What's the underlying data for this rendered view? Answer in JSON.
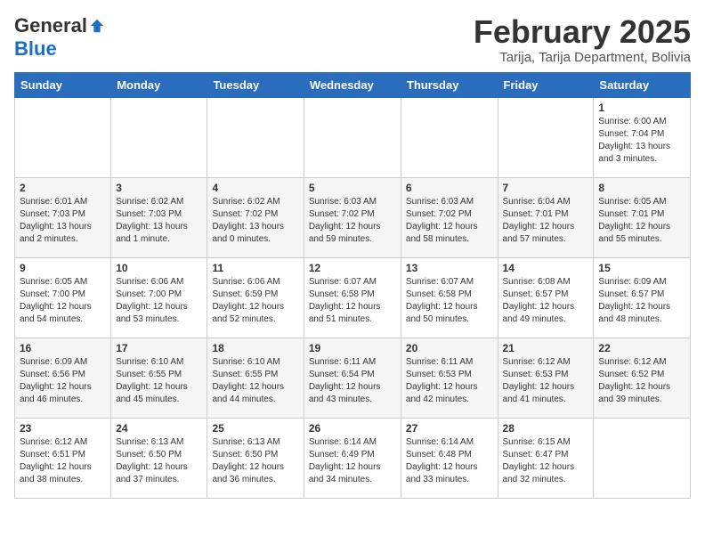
{
  "header": {
    "logo_general": "General",
    "logo_blue": "Blue",
    "month_title": "February 2025",
    "location": "Tarija, Tarija Department, Bolivia"
  },
  "weekdays": [
    "Sunday",
    "Monday",
    "Tuesday",
    "Wednesday",
    "Thursday",
    "Friday",
    "Saturday"
  ],
  "weeks": [
    [
      null,
      null,
      null,
      null,
      null,
      null,
      {
        "day": "1",
        "sunrise": "6:00 AM",
        "sunset": "7:04 PM",
        "daylight": "13 hours and 3 minutes."
      }
    ],
    [
      {
        "day": "2",
        "sunrise": "6:01 AM",
        "sunset": "7:03 PM",
        "daylight": "13 hours and 2 minutes."
      },
      {
        "day": "3",
        "sunrise": "6:02 AM",
        "sunset": "7:03 PM",
        "daylight": "13 hours and 1 minute."
      },
      {
        "day": "4",
        "sunrise": "6:02 AM",
        "sunset": "7:02 PM",
        "daylight": "13 hours and 0 minutes."
      },
      {
        "day": "5",
        "sunrise": "6:03 AM",
        "sunset": "7:02 PM",
        "daylight": "12 hours and 59 minutes."
      },
      {
        "day": "6",
        "sunrise": "6:03 AM",
        "sunset": "7:02 PM",
        "daylight": "12 hours and 58 minutes."
      },
      {
        "day": "7",
        "sunrise": "6:04 AM",
        "sunset": "7:01 PM",
        "daylight": "12 hours and 57 minutes."
      },
      {
        "day": "8",
        "sunrise": "6:05 AM",
        "sunset": "7:01 PM",
        "daylight": "12 hours and 55 minutes."
      }
    ],
    [
      {
        "day": "9",
        "sunrise": "6:05 AM",
        "sunset": "7:00 PM",
        "daylight": "12 hours and 54 minutes."
      },
      {
        "day": "10",
        "sunrise": "6:06 AM",
        "sunset": "7:00 PM",
        "daylight": "12 hours and 53 minutes."
      },
      {
        "day": "11",
        "sunrise": "6:06 AM",
        "sunset": "6:59 PM",
        "daylight": "12 hours and 52 minutes."
      },
      {
        "day": "12",
        "sunrise": "6:07 AM",
        "sunset": "6:58 PM",
        "daylight": "12 hours and 51 minutes."
      },
      {
        "day": "13",
        "sunrise": "6:07 AM",
        "sunset": "6:58 PM",
        "daylight": "12 hours and 50 minutes."
      },
      {
        "day": "14",
        "sunrise": "6:08 AM",
        "sunset": "6:57 PM",
        "daylight": "12 hours and 49 minutes."
      },
      {
        "day": "15",
        "sunrise": "6:09 AM",
        "sunset": "6:57 PM",
        "daylight": "12 hours and 48 minutes."
      }
    ],
    [
      {
        "day": "16",
        "sunrise": "6:09 AM",
        "sunset": "6:56 PM",
        "daylight": "12 hours and 46 minutes."
      },
      {
        "day": "17",
        "sunrise": "6:10 AM",
        "sunset": "6:55 PM",
        "daylight": "12 hours and 45 minutes."
      },
      {
        "day": "18",
        "sunrise": "6:10 AM",
        "sunset": "6:55 PM",
        "daylight": "12 hours and 44 minutes."
      },
      {
        "day": "19",
        "sunrise": "6:11 AM",
        "sunset": "6:54 PM",
        "daylight": "12 hours and 43 minutes."
      },
      {
        "day": "20",
        "sunrise": "6:11 AM",
        "sunset": "6:53 PM",
        "daylight": "12 hours and 42 minutes."
      },
      {
        "day": "21",
        "sunrise": "6:12 AM",
        "sunset": "6:53 PM",
        "daylight": "12 hours and 41 minutes."
      },
      {
        "day": "22",
        "sunrise": "6:12 AM",
        "sunset": "6:52 PM",
        "daylight": "12 hours and 39 minutes."
      }
    ],
    [
      {
        "day": "23",
        "sunrise": "6:12 AM",
        "sunset": "6:51 PM",
        "daylight": "12 hours and 38 minutes."
      },
      {
        "day": "24",
        "sunrise": "6:13 AM",
        "sunset": "6:50 PM",
        "daylight": "12 hours and 37 minutes."
      },
      {
        "day": "25",
        "sunrise": "6:13 AM",
        "sunset": "6:50 PM",
        "daylight": "12 hours and 36 minutes."
      },
      {
        "day": "26",
        "sunrise": "6:14 AM",
        "sunset": "6:49 PM",
        "daylight": "12 hours and 34 minutes."
      },
      {
        "day": "27",
        "sunrise": "6:14 AM",
        "sunset": "6:48 PM",
        "daylight": "12 hours and 33 minutes."
      },
      {
        "day": "28",
        "sunrise": "6:15 AM",
        "sunset": "6:47 PM",
        "daylight": "12 hours and 32 minutes."
      },
      null
    ]
  ]
}
